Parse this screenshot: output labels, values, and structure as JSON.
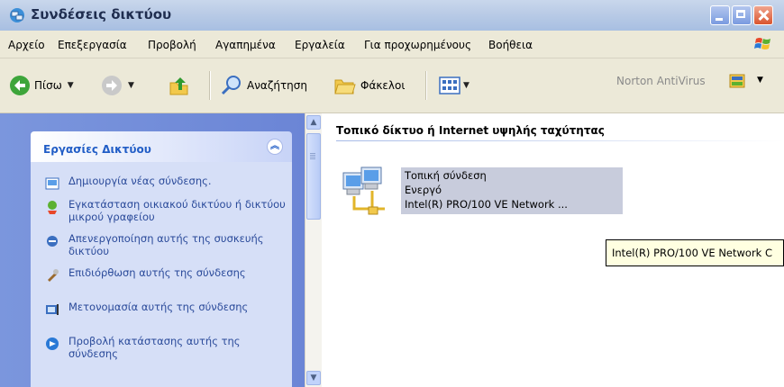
{
  "window": {
    "title": "Συνδέσεις δικτύου"
  },
  "menu": {
    "items": [
      "Αρχείο",
      "Επεξεργασία",
      "Προβολή",
      "Αγαπημένα",
      "Εργαλεία",
      "Για προχωρημένους",
      "Βοήθεια"
    ]
  },
  "toolbar": {
    "back_label": "Πίσω",
    "search_label": "Αναζήτηση",
    "folders_label": "Φάκελοι",
    "norton_label": "Norton AntiVirus"
  },
  "tasks": {
    "header": "Εργασίες Δικτύου",
    "items": [
      {
        "label": "Δημιουργία νέας σύνδεσης.",
        "icon": "new-connection-icon"
      },
      {
        "label": "Εγκατάσταση οικιακού δικτύου ή δικτύου μικρού γραφείου",
        "icon": "home-network-wizard-icon"
      },
      {
        "label": "Απενεργοποίηση αυτής της συσκευής δικτύου",
        "icon": "disable-device-icon"
      },
      {
        "label": "Επιδιόρθωση αυτής της σύνδεσης",
        "icon": "repair-icon"
      },
      {
        "label": "Μετονομασία αυτής της σύνδεσης",
        "icon": "rename-icon"
      },
      {
        "label": "Προβολή κατάστασης αυτής της σύνδεσης",
        "icon": "status-icon"
      }
    ]
  },
  "content": {
    "group_title": "Τοπικό δίκτυο ή Internet υψηλής ταχύτητας",
    "connection": {
      "name": "Τοπική σύνδεση",
      "status": "Ενεργό",
      "device": "Intel(R) PRO/100 VE Network ..."
    },
    "tooltip": "Intel(R) PRO/100 VE Network C"
  },
  "colors": {
    "task_link": "#2a4a9a",
    "task_header": "#215dc6",
    "pane_bg": "#7b96dd"
  }
}
